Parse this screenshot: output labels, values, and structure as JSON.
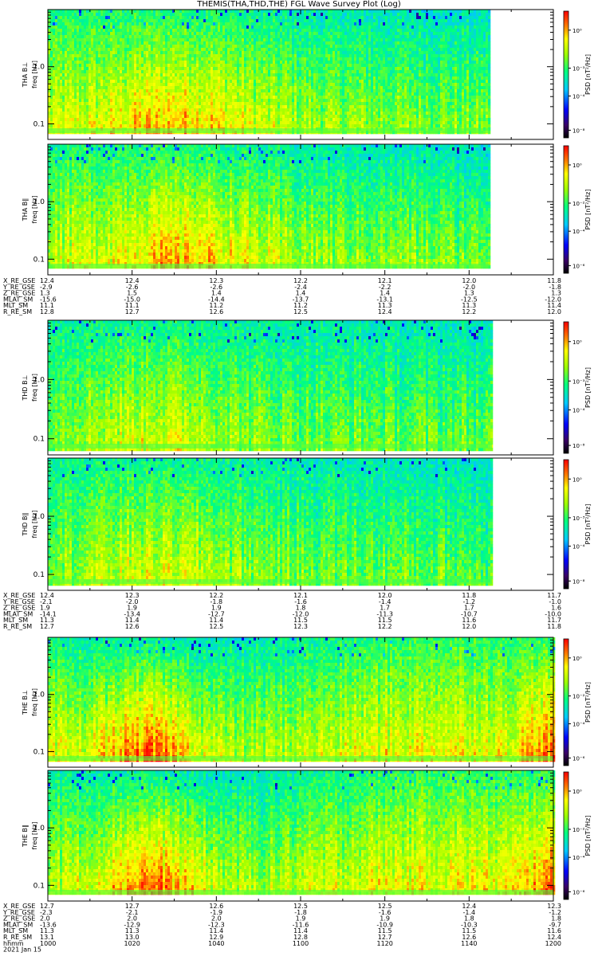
{
  "title": "THEMIS(THA,THD,THE) FGL Wave Survey Plot (Log)",
  "colorbar_label": "PSD [nT²/Hz]",
  "colorbar_ticks": [
    "10⁰",
    "10⁻³",
    "10⁻⁴",
    "10⁻⁸"
  ],
  "colorbar_ticks_panel2": [
    "10⁰",
    "10⁻²",
    "10⁻⁴",
    "10⁻⁶"
  ],
  "colorbar_ticks_panel5": [
    "10⁰",
    "10⁻²",
    "10⁻⁴",
    "10⁻⁶"
  ],
  "colorbar_ticks_panel6": [
    "10⁰",
    "10⁻²",
    "10⁻⁴",
    "10⁻⁶"
  ],
  "freq_ticks": [
    "1.0",
    "0.1"
  ],
  "freq_unit_label": "freq [Hz]",
  "chart_data": [
    {
      "type": "heatmap",
      "probe": "THA",
      "ylabel": "THA B⊥",
      "ylabel_freq": "freq [Hz]",
      "scale": "log",
      "yticks": [
        1.0,
        0.1
      ],
      "intensity_profile": "moderate",
      "colorbar_ticks": [
        "10⁰",
        "10⁻³",
        "10⁻⁴",
        "10⁻⁸"
      ]
    },
    {
      "type": "heatmap",
      "probe": "THA",
      "ylabel": "THA B∥",
      "ylabel_freq": "freq [Hz]",
      "scale": "log",
      "yticks": [
        1.0,
        0.1
      ],
      "intensity_profile": "moderate",
      "colorbar_ticks": [
        "10⁰",
        "10⁻²",
        "10⁻⁴",
        "10⁻⁶"
      ]
    },
    {
      "type": "heatmap",
      "probe": "THD",
      "ylabel": "THD B⊥",
      "ylabel_freq": "freq [Hz]",
      "scale": "log",
      "yticks": [
        1.0,
        0.1
      ],
      "intensity_profile": "low",
      "colorbar_ticks": [
        "10⁰",
        "10⁻³",
        "10⁻⁴",
        "10⁻⁸"
      ]
    },
    {
      "type": "heatmap",
      "probe": "THD",
      "ylabel": "THD B∥",
      "ylabel_freq": "freq [Hz]",
      "scale": "log",
      "yticks": [
        1.0,
        0.1
      ],
      "intensity_profile": "low",
      "colorbar_ticks": [
        "10⁰",
        "10⁻³",
        "10⁻⁴",
        "10⁻⁸"
      ]
    },
    {
      "type": "heatmap",
      "probe": "THE",
      "ylabel": "THE B⊥",
      "ylabel_freq": "freq [Hz]",
      "scale": "log",
      "yticks": [
        1.0,
        0.1
      ],
      "intensity_profile": "high",
      "colorbar_ticks": [
        "10⁰",
        "10⁻²",
        "10⁻⁴",
        "10⁻⁶"
      ]
    },
    {
      "type": "heatmap",
      "probe": "THE",
      "ylabel": "THE B∥",
      "ylabel_freq": "freq [Hz]",
      "scale": "log",
      "yticks": [
        1.0,
        0.1
      ],
      "intensity_profile": "high",
      "colorbar_ticks": [
        "10⁰",
        "10⁻²",
        "10⁻⁴",
        "10⁻⁶"
      ]
    }
  ],
  "ephemeris": [
    {
      "probe": "THA",
      "rows": [
        {
          "label": "X_RE_GSE",
          "values": [
            "12.4",
            "12.4",
            "12.3",
            "12.2",
            "12.1",
            "12.0",
            "11.8"
          ]
        },
        {
          "label": "Y_RE_GSE",
          "values": [
            "-2.9",
            "-2.6",
            "-2.6",
            "-2.4",
            "-2.2",
            "-2.0",
            "-1.8"
          ]
        },
        {
          "label": "Z_RE_GSE",
          "values": [
            "1.3",
            "1.5",
            "1.4",
            "1.4",
            "1.4",
            "1.3",
            "1.3"
          ]
        },
        {
          "label": "MLAT_SM",
          "values": [
            "-15.6",
            "-15.0",
            "-14.4",
            "-13.7",
            "-13.1",
            "-12.5",
            "-12.0"
          ]
        },
        {
          "label": "MLT_SM",
          "values": [
            "11.1",
            "11.1",
            "11.2",
            "11.2",
            "11.3",
            "11.3",
            "11.4"
          ]
        },
        {
          "label": "R_RE_SM",
          "values": [
            "12.8",
            "12.7",
            "12.6",
            "12.5",
            "12.4",
            "12.2",
            "12.0"
          ]
        }
      ]
    },
    {
      "probe": "THD",
      "rows": [
        {
          "label": "X_RE_GSE",
          "values": [
            "12.4",
            "12.3",
            "12.2",
            "12.1",
            "12.0",
            "11.8",
            "11.7"
          ]
        },
        {
          "label": "Y_RE_GSE",
          "values": [
            "-2.1",
            "-2.0",
            "-1.8",
            "-1.6",
            "-1.4",
            "-1.2",
            "-1.0"
          ]
        },
        {
          "label": "Z_RE_GSE",
          "values": [
            "1.9",
            "1.9",
            "1.9",
            "1.8",
            "1.7",
            "1.7",
            "1.6"
          ]
        },
        {
          "label": "MLAT_SM",
          "values": [
            "-14.1",
            "-13.4",
            "-12.7",
            "-12.0",
            "-11.3",
            "-10.7",
            "-10.0"
          ]
        },
        {
          "label": "MLT_SM",
          "values": [
            "11.3",
            "11.4",
            "11.4",
            "11.5",
            "11.5",
            "11.6",
            "11.7"
          ]
        },
        {
          "label": "R_RE_SM",
          "values": [
            "12.7",
            "12.6",
            "12.5",
            "12.3",
            "12.2",
            "12.0",
            "11.8"
          ]
        }
      ]
    },
    {
      "probe": "THE",
      "rows": [
        {
          "label": "X_RE_GSE",
          "values": [
            "12.7",
            "12.7",
            "12.6",
            "12.5",
            "12.5",
            "12.4",
            "12.3"
          ]
        },
        {
          "label": "Y_RE_GSE",
          "values": [
            "-2.3",
            "-2.1",
            "-1.9",
            "-1.8",
            "-1.6",
            "-1.4",
            "-1.2"
          ]
        },
        {
          "label": "Z_RE_GSE",
          "values": [
            "2.0",
            "2.0",
            "2.0",
            "1.9",
            "1.9",
            "1.8",
            "1.8"
          ]
        },
        {
          "label": "MLAT_SM",
          "values": [
            "-13.6",
            "-12.9",
            "-12.3",
            "-11.6",
            "-10.9",
            "-10.3",
            "-9.7"
          ]
        },
        {
          "label": "MLT_SM",
          "values": [
            "11.3",
            "11.3",
            "11.4",
            "11.4",
            "11.5",
            "11.5",
            "11.6"
          ]
        },
        {
          "label": "R_RE_SM",
          "values": [
            "13.1",
            "13.0",
            "12.9",
            "12.8",
            "12.7",
            "12.6",
            "12.4"
          ]
        },
        {
          "label": "hhmm",
          "values": [
            "1000",
            "1020",
            "1040",
            "1100",
            "1120",
            "1140",
            "1200"
          ]
        }
      ]
    }
  ],
  "date_label": "2021 Jan 15"
}
